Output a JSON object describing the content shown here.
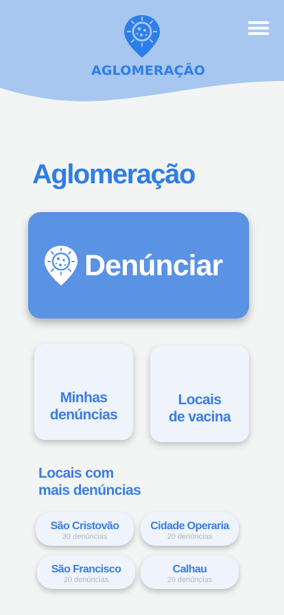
{
  "header": {
    "brand": "AGLOMERAÇÃO",
    "logo_icon": "virus-location-pin-icon",
    "menu_icon": "hamburger-menu-icon"
  },
  "main": {
    "title": "Aglomeração",
    "report_button": {
      "label": "Denúnciar",
      "icon": "virus-location-pin-icon"
    },
    "cards": [
      {
        "label": "Minhas\ndenúncias"
      },
      {
        "label": "Locais\nde vacina"
      }
    ],
    "section_title": "Locais com\nmais denúncias",
    "places": [
      {
        "name": "São Cristovão",
        "count": "30 denúncias"
      },
      {
        "name": "Cidade Operaria",
        "count": "20 denúncias"
      },
      {
        "name": "São Francisco",
        "count": "20 denúncias"
      },
      {
        "name": "Calhau",
        "count": "20 denúncias"
      }
    ]
  },
  "colors": {
    "header_wave": "#a7c7f0",
    "primary": "#2f7de6",
    "button": "#5a92e4",
    "card": "#eef3fc",
    "background": "#f3f5f5"
  }
}
